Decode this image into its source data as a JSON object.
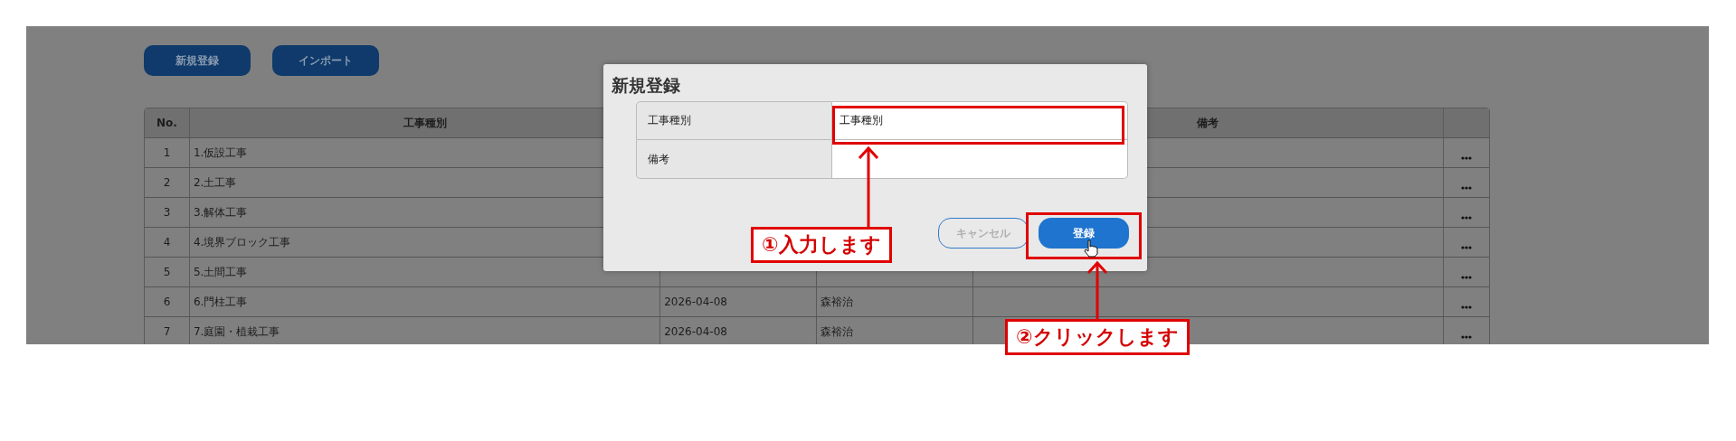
{
  "toolbar": {
    "buttons": [
      "新規登録",
      "インポート"
    ]
  },
  "table": {
    "columns": [
      "No.",
      "工事種別",
      "備考"
    ],
    "rows": [
      {
        "no": "1",
        "type": "1.仮設工事"
      },
      {
        "no": "2",
        "type": "2.土工事"
      },
      {
        "no": "3",
        "type": "3.解体工事"
      },
      {
        "no": "4",
        "type": "4.境界ブロック工事"
      },
      {
        "no": "5",
        "type": "5.土間工事"
      },
      {
        "no": "6",
        "type": "6.門柱工事",
        "date": "2026-04-08",
        "person": "森裕治"
      },
      {
        "no": "7",
        "type": "7.庭園・植栽工事",
        "date": "2026-04-08",
        "person": "森裕治"
      }
    ]
  },
  "dialog": {
    "title": "新規登録",
    "fields": [
      {
        "label": "工事種別",
        "value": "工事種別"
      },
      {
        "label": "備考"
      }
    ],
    "buttons": [
      {
        "label": "キャンセル",
        "kind": "secondary"
      },
      {
        "label": "登録",
        "kind": "primary"
      }
    ]
  },
  "annotations": [
    {
      "text": "①入力します"
    },
    {
      "text": "②クリックします"
    }
  ]
}
